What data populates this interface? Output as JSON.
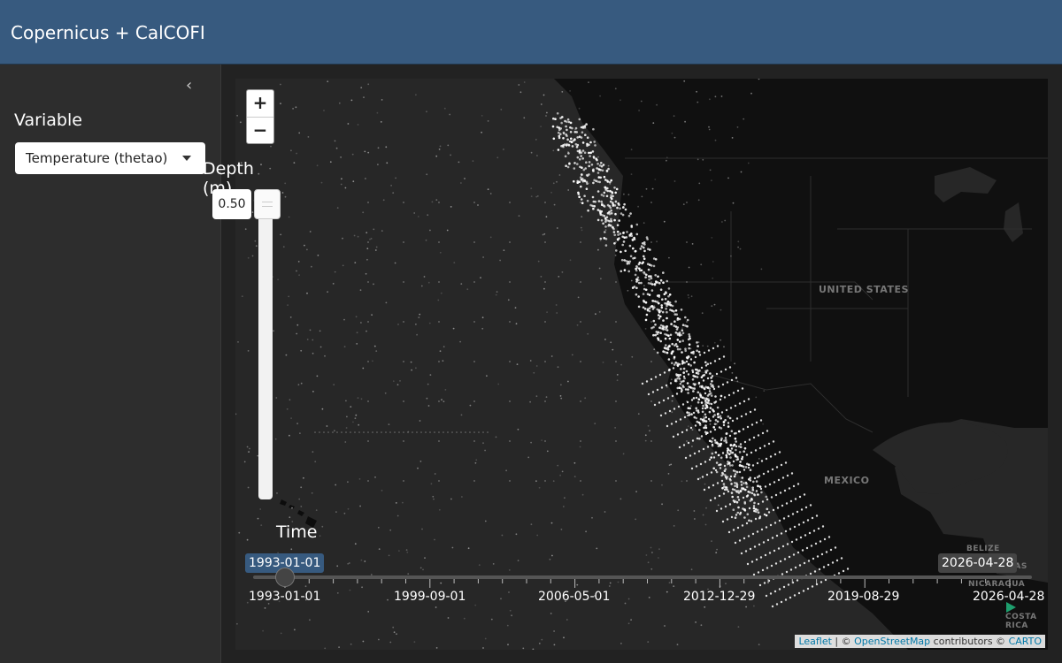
{
  "app": {
    "title": "Copernicus + CalCOFI"
  },
  "sidebar": {
    "collapse_icon": "chevron-left-icon",
    "variable_label": "Variable",
    "variable_select": {
      "selected": "Temperature (thetao)"
    }
  },
  "map": {
    "zoom_in": "+",
    "zoom_out": "−",
    "depth": {
      "title": "Depth (m)",
      "value": "0.50"
    },
    "time": {
      "title": "Time",
      "from": "1993-01-01",
      "to": "2026-04-28",
      "ticks": [
        "1993-01-01",
        "1999-09-01",
        "2006-05-01",
        "2012-12-29",
        "2019-08-29",
        "2026-04-28"
      ]
    },
    "labels": {
      "us": "UNITED STATES",
      "mexico": "MEXICO",
      "belize": "BELIZE",
      "honduras": "HONDURAS",
      "nicaragua": "NICARAGUA",
      "costa_rica": "COSTA RICA"
    },
    "attribution": {
      "leaflet": "Leaflet",
      "sep": " | © ",
      "osm": "OpenStreetMap",
      "contrib": " contributors © ",
      "carto": "CARTO"
    }
  },
  "colors": {
    "navbar": "#375a7f",
    "sidebar": "#2d2d2d",
    "map_bg": "#272727",
    "land": "#101010",
    "accent": "#1e9f6e"
  }
}
